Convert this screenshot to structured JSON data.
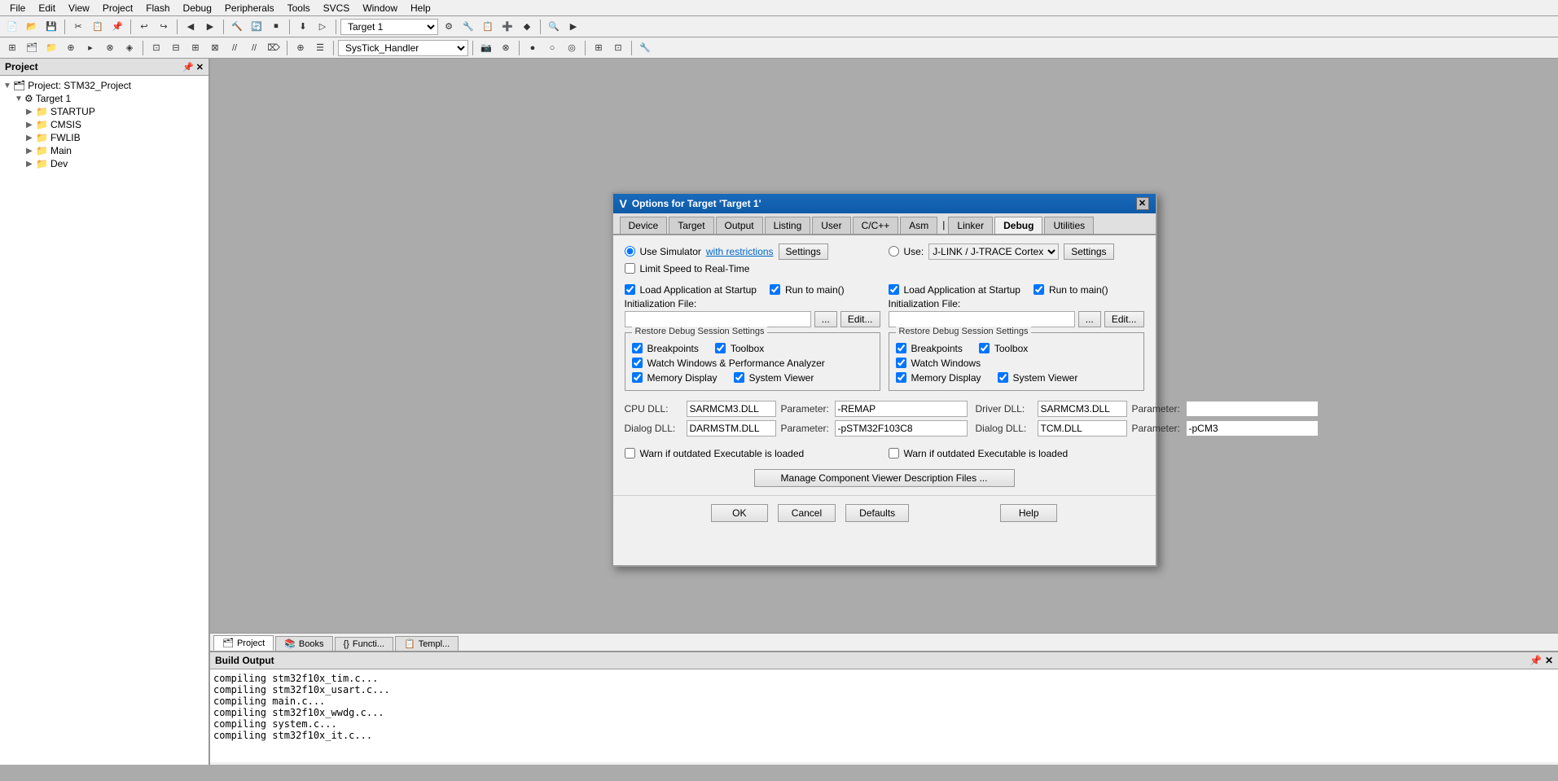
{
  "menubar": {
    "items": [
      "File",
      "Edit",
      "View",
      "Project",
      "Flash",
      "Debug",
      "Peripherals",
      "Tools",
      "SVCS",
      "Window",
      "Help"
    ]
  },
  "toolbar": {
    "target_dropdown": "Target 1",
    "function_dropdown": "SysTick_Handler"
  },
  "project_panel": {
    "title": "Project",
    "project_name": "Project: STM32_Project",
    "target": "Target 1",
    "items": [
      "STARTUP",
      "CMSIS",
      "FWLIB",
      "Main",
      "Dev"
    ]
  },
  "dialog": {
    "title": "Options for Target 'Target 1'",
    "tabs": [
      "Device",
      "Target",
      "Output",
      "Listing",
      "User",
      "C/C++",
      "Asm",
      "Linker",
      "Debug",
      "Utilities"
    ],
    "active_tab": "Debug",
    "simulator": {
      "label": "Use Simulator",
      "with_restrictions_link": "with restrictions",
      "settings_btn": "Settings",
      "limit_speed": "Limit Speed to Real-Time"
    },
    "use_section": {
      "label": "Use:",
      "dropdown_value": "J-LINK / J-TRACE Cortex",
      "settings_btn": "Settings"
    },
    "left_col": {
      "load_app": "Load Application at Startup",
      "run_to_main": "Run to main()",
      "init_file_label": "Initialization File:",
      "restore_title": "Restore Debug Session Settings",
      "breakpoints": "Breakpoints",
      "toolbox": "Toolbox",
      "watch_windows": "Watch Windows & Performance Analyzer",
      "memory_display": "Memory Display",
      "system_viewer": "System Viewer"
    },
    "right_col": {
      "load_app": "Load Application at Startup",
      "run_to_main": "Run to main()",
      "init_file_label": "Initialization File:",
      "restore_title": "Restore Debug Session Settings",
      "breakpoints": "Breakpoints",
      "toolbox": "Toolbox",
      "watch_windows": "Watch Windows",
      "memory_display": "Memory Display",
      "system_viewer": "System Viewer"
    },
    "cpu_dll_label": "CPU DLL:",
    "cpu_dll_value": "SARMCM3.DLL",
    "cpu_param_label": "Parameter:",
    "cpu_param_value": "-REMAP",
    "dialog_dll_label": "Dialog DLL:",
    "dialog_dll_value": "DARMSTM.DLL",
    "dialog_param_label": "Parameter:",
    "dialog_param_value": "-pSTM32F103C8",
    "driver_dll_label": "Driver DLL:",
    "driver_dll_value": "SARMCM3.DLL",
    "driver_param_label": "Parameter:",
    "driver_param_value": "",
    "dialog_dll2_label": "Dialog DLL:",
    "dialog_dll2_value": "TCM.DLL",
    "dialog_param2_label": "Parameter:",
    "dialog_param2_value": "-pCM3",
    "warn_label": "Warn if outdated Executable is loaded",
    "warn_label2": "Warn if outdated Executable is loaded",
    "manage_btn": "Manage Component Viewer Description Files ...",
    "ok_btn": "OK",
    "cancel_btn": "Cancel",
    "defaults_btn": "Defaults",
    "help_btn": "Help"
  },
  "bottom_tabs": [
    "Project",
    "Books",
    "Functi...",
    "Templ..."
  ],
  "bottom_panel": {
    "title": "Build Output",
    "lines": [
      "compiling stm32f10x_tim.c...",
      "compiling stm32f10x_usart.c...",
      "compiling main.c...",
      "compiling stm32f10x_wwdg.c...",
      "compiling system.c...",
      "compiling stm32f10x_it.c..."
    ]
  },
  "icons": {
    "expand": "▶",
    "collapse": "▼",
    "folder": "📁",
    "project": "🗂",
    "target": "⚙",
    "close": "✕",
    "pin": "📌",
    "minimize": "—"
  }
}
